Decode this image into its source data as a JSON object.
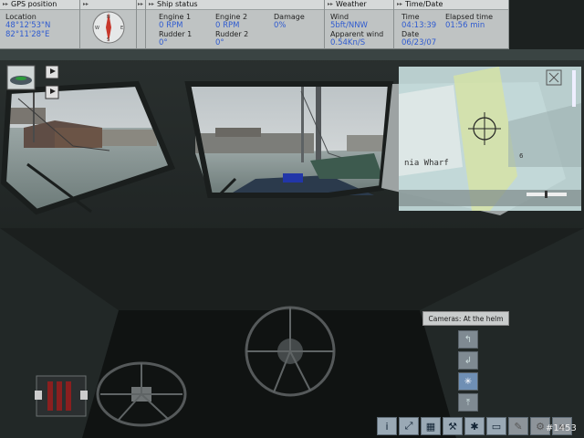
{
  "hud": {
    "gps": {
      "title": "GPS position",
      "location_label": "Location",
      "lat": "48°12'53\"N",
      "lon": "82°11'28\"E"
    },
    "compass": {
      "n": "N",
      "e": "E",
      "s": "S",
      "w": "W"
    },
    "ship": {
      "title": "Ship status",
      "engine1_label": "Engine 1",
      "engine1_value": "0 RPM",
      "engine2_label": "Engine 2",
      "engine2_value": "0 RPM",
      "damage_label": "Damage",
      "damage_value": "0%",
      "rudder1_label": "Rudder 1",
      "rudder1_value": "0°",
      "rudder2_label": "Rudder 2",
      "rudder2_value": "0°"
    },
    "weather": {
      "title": "Weather",
      "wind_label": "Wind",
      "wind_value": "5bft/NNW",
      "apparent_label": "Apparent wind",
      "apparent_value": "0.54Kn/S"
    },
    "time": {
      "title": "Time/Date",
      "time_label": "Time",
      "time_value": "04:13:39",
      "elapsed_label": "Elapsed time",
      "elapsed_value": "01:56 min",
      "date_label": "Date",
      "date_value": "06/23/07"
    }
  },
  "minimap": {
    "place_label": "nia Wharf",
    "distance_label": "6"
  },
  "camera": {
    "tooltip": "Cameras: At the helm"
  },
  "toolbar": {
    "icons": [
      "info-icon",
      "chart-icon",
      "map-icon",
      "tools-icon",
      "camera-icon",
      "monitor-icon",
      "note-icon",
      "settings-icon",
      "extra-icon"
    ]
  },
  "screenshot_id": "#1453",
  "colors": {
    "hud_bg": "#bfc3c3",
    "value_blue": "#2f5bd0",
    "cabin_dark": "#1f2423"
  }
}
